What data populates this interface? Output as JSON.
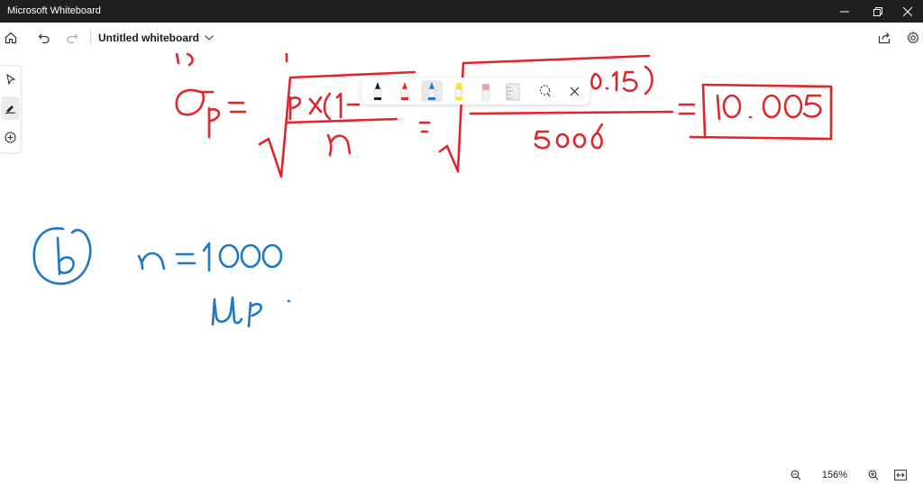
{
  "window": {
    "title": "Microsoft Whiteboard",
    "titlebar_color": "#1f1f1f"
  },
  "toolbar": {
    "board_name": "Untitled whiteboard",
    "icons": [
      "home-icon",
      "undo-icon",
      "redo-icon",
      "chevron-down-icon",
      "share-icon",
      "settings-icon"
    ]
  },
  "left_rail": {
    "tools": [
      "select-arrow-icon",
      "inking-icon",
      "add-icon"
    ],
    "active": "inking-icon"
  },
  "pen_tray": {
    "tools": [
      {
        "name": "black-pen",
        "color": "#1a1a1a"
      },
      {
        "name": "red-pen",
        "color": "#e0262b"
      },
      {
        "name": "blue-pen",
        "color": "#1e78c8"
      },
      {
        "name": "yellow-highlighter",
        "color": "#f7e531"
      },
      {
        "name": "eraser",
        "color": "#f2a0a8"
      },
      {
        "name": "ruler",
        "color": "#cfcfcf"
      },
      {
        "name": "lasso-select",
        "color": "#444444"
      }
    ],
    "selected": "blue-pen"
  },
  "ink_colors": {
    "red": "#e0262b",
    "blue": "#1e78c8"
  },
  "zoom": {
    "level": "156%"
  }
}
